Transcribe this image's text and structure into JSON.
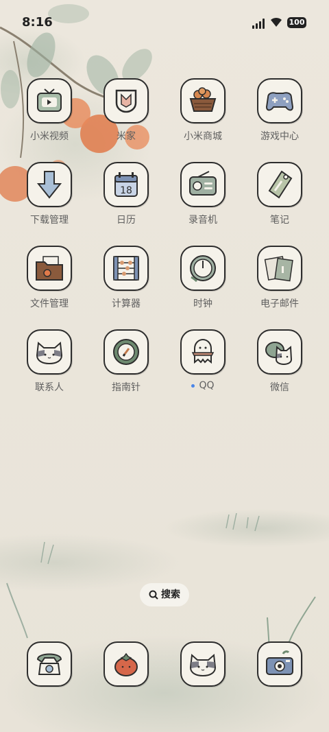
{
  "status_bar": {
    "time": "8:16",
    "battery": "100",
    "signal_icon": "signal-icon",
    "wifi_icon": "wifi-icon"
  },
  "apps": [
    {
      "label": "小米视频",
      "icon": "tv-icon"
    },
    {
      "label": "米家",
      "icon": "mijia-icon"
    },
    {
      "label": "小米商城",
      "icon": "basket-icon"
    },
    {
      "label": "游戏中心",
      "icon": "gamepad-icon"
    },
    {
      "label": "下载管理",
      "icon": "download-arrow-icon"
    },
    {
      "label": "日历",
      "icon": "calendar-icon",
      "calendar_day": "18"
    },
    {
      "label": "录音机",
      "icon": "radio-recorder-icon"
    },
    {
      "label": "笔记",
      "icon": "note-tag-icon"
    },
    {
      "label": "文件管理",
      "icon": "folder-icon"
    },
    {
      "label": "计算器",
      "icon": "abacus-icon"
    },
    {
      "label": "时钟",
      "icon": "clock-icon"
    },
    {
      "label": "电子邮件",
      "icon": "mail-cards-icon"
    },
    {
      "label": "联系人",
      "icon": "cat-contacts-icon"
    },
    {
      "label": "指南针",
      "icon": "compass-icon"
    },
    {
      "label": "QQ",
      "icon": "qq-ghost-icon",
      "badge": "new-dot"
    },
    {
      "label": "微信",
      "icon": "cat-wechat-icon"
    }
  ],
  "search": {
    "label": "搜索",
    "icon": "search-icon"
  },
  "dock": [
    {
      "icon": "phone-icon"
    },
    {
      "icon": "tomato-icon"
    },
    {
      "icon": "cat-icon"
    },
    {
      "icon": "camera-icon"
    }
  ],
  "colors": {
    "wallpaper": "#ebe6dc",
    "icon_bg": "#f5f2ea",
    "icon_outline": "#2d2d2d",
    "label": "#5f5f5f",
    "persimmon": "#e07a4a",
    "leaf": "#8fa592",
    "notification_dot": "#4a86e8"
  }
}
